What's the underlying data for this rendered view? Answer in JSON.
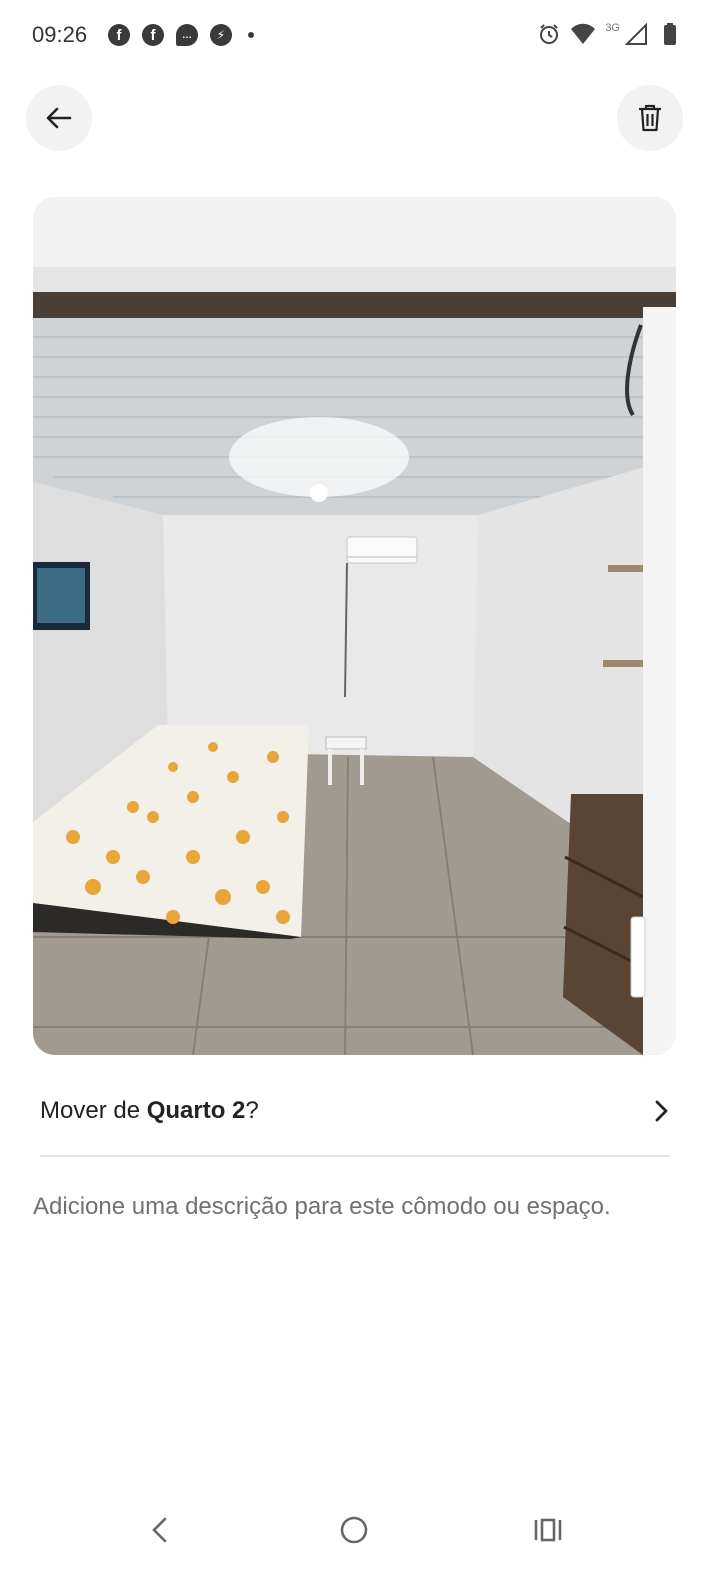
{
  "status_bar": {
    "time": "09:26",
    "left_icons": [
      "facebook-icon",
      "facebook-icon",
      "chat-bubble-icon",
      "messenger-icon",
      "dot-icon"
    ],
    "network_label": "3G",
    "right_icons": [
      "alarm-icon",
      "wifi-icon",
      "signal-icon",
      "battery-icon"
    ]
  },
  "header": {
    "back_icon": "arrow-left-icon",
    "delete_icon": "trash-icon"
  },
  "photo": {
    "subject": "room-photo"
  },
  "move": {
    "prefix": "Mover de ",
    "room": "Quarto 2",
    "suffix": "?",
    "icon": "chevron-right-icon"
  },
  "description": {
    "placeholder": "Adicione uma descrição para este cômodo ou espaço."
  },
  "nav": {
    "icons": [
      "nav-back-icon",
      "nav-home-icon",
      "nav-recents-icon"
    ]
  }
}
